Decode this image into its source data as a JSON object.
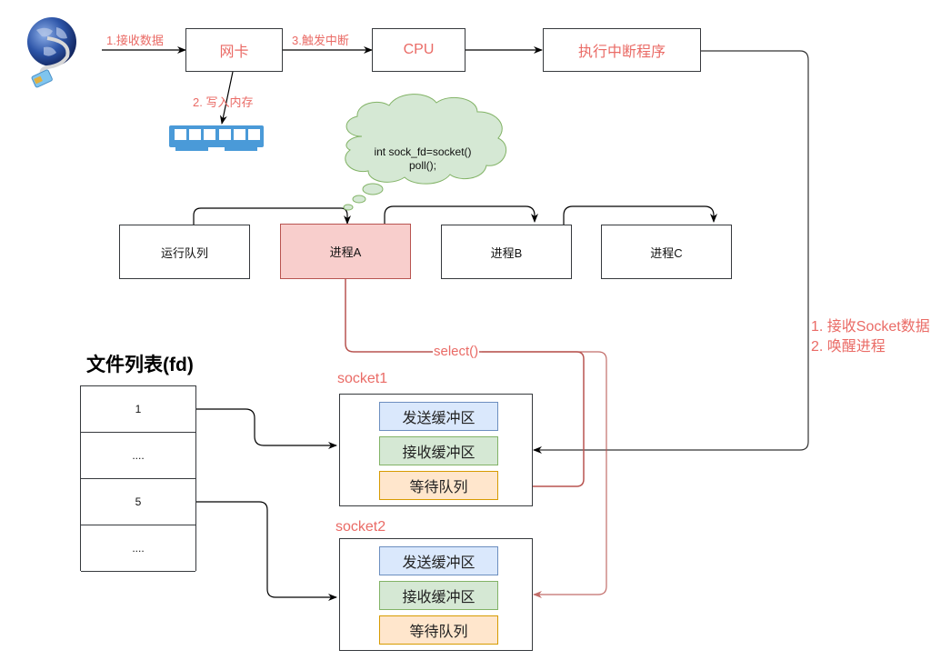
{
  "network": {
    "step1_label": "1.接收数据",
    "nic_label": "网卡",
    "step2_label": "2. 写入内存",
    "step3_label": "3.触发中断",
    "cpu_label": "CPU",
    "interrupt_handler_label": "执行中断程序",
    "globe_icon": "network-globe-icon",
    "memory_icon": "memory-module-icon"
  },
  "thought": {
    "line1": "int sock_fd=socket()",
    "line2": "poll();"
  },
  "processes": {
    "run_queue": "运行队列",
    "items": [
      "进程A",
      "进程B",
      "进程C"
    ]
  },
  "select_label": "select()",
  "interrupt_note": {
    "line1": "1. 接收Socket数据",
    "line2": "2. 唤醒进程"
  },
  "fd_table": {
    "title": "文件列表(fd)",
    "rows": [
      "1",
      "....",
      "5",
      "...."
    ]
  },
  "sockets": [
    {
      "name": "socket1",
      "send": "发送缓冲区",
      "recv": "接收缓冲区",
      "wait": "等待队列"
    },
    {
      "name": "socket2",
      "send": "发送缓冲区",
      "recv": "接收缓冲区",
      "wait": "等待队列"
    }
  ],
  "colors": {
    "accent_red": "#ea6b66",
    "wire_red": "#b85450",
    "process_a_fill": "#f8cecc",
    "send_fill": "#dae8fc",
    "recv_fill": "#d5e8d4",
    "wait_fill": "#ffe6cc",
    "cloud_fill": "#d5e8d4"
  }
}
